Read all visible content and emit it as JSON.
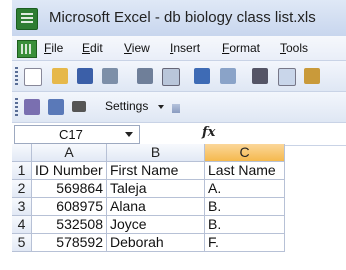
{
  "titlebar": {
    "title": "Microsoft Excel - db biology class list.xls"
  },
  "menubar": {
    "items": [
      "File",
      "Edit",
      "View",
      "Insert",
      "Format",
      "Tools"
    ]
  },
  "toolbar2": {
    "settings_label": "Settings"
  },
  "formula_bar": {
    "cell_ref": "C17",
    "fx_label": "fx"
  },
  "sheet": {
    "columns": [
      "A",
      "B",
      "C"
    ],
    "selected_column": "C",
    "rows": [
      {
        "row": "1",
        "cells": [
          "ID Number",
          "First Name",
          "Last Name"
        ]
      },
      {
        "row": "2",
        "cells": [
          "569864",
          "Taleja",
          "A."
        ]
      },
      {
        "row": "3",
        "cells": [
          "608975",
          "Alana",
          "B."
        ]
      },
      {
        "row": "4",
        "cells": [
          "532508",
          "Joyce",
          "B."
        ]
      },
      {
        "row": "5",
        "cells": [
          "578592",
          "Deborah",
          "F."
        ]
      }
    ]
  },
  "colors": {
    "selected_header": "#f5b94e",
    "excel_green": "#2e7d32"
  }
}
